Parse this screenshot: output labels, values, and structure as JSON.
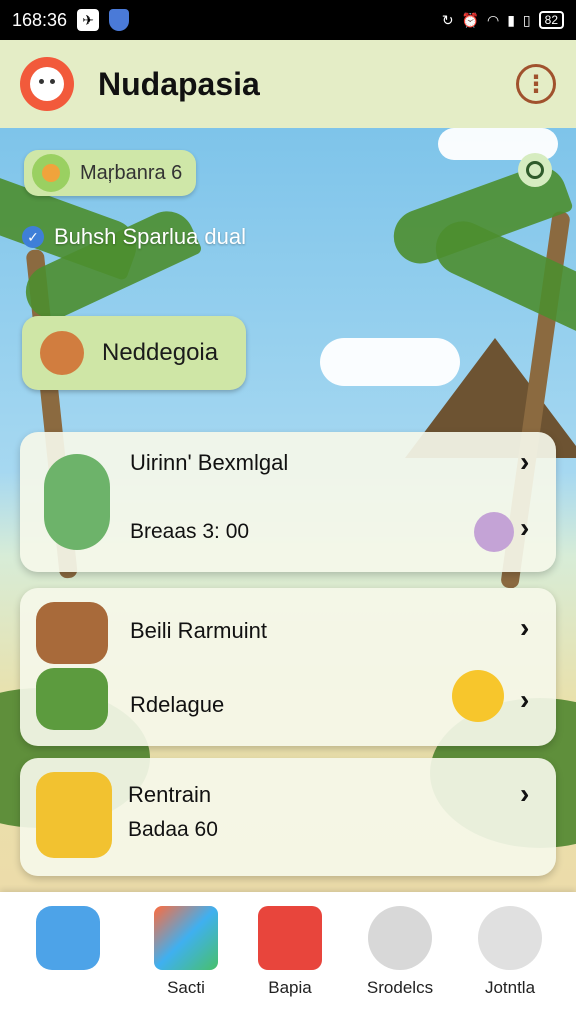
{
  "status_bar": {
    "time": "168:36",
    "battery": "82"
  },
  "app_bar": {
    "title": "Nudapasia"
  },
  "top_chip": {
    "label": "Maŗbanra 6"
  },
  "notice": {
    "text": "Buhsh Sparlua dual"
  },
  "bubble": {
    "label": "Neddegoia"
  },
  "cards": [
    {
      "title": "Uirinn' Bexmlgal",
      "subtitle": "Breaas 3: 00"
    },
    {
      "title": "Beili Rarmuint",
      "subtitle": "Rdelague"
    },
    {
      "title": "Rentrain",
      "subtitle": "Badaa 60"
    }
  ],
  "nav": [
    {
      "label": "",
      "icon": "home-app-icon"
    },
    {
      "label": "Sacti",
      "icon": "play-store-icon"
    },
    {
      "label": "Bapia",
      "icon": "video-icon"
    },
    {
      "label": "Srodelcs",
      "icon": "camera-icon"
    },
    {
      "label": "Jotntla",
      "icon": "security-camera-icon"
    }
  ]
}
